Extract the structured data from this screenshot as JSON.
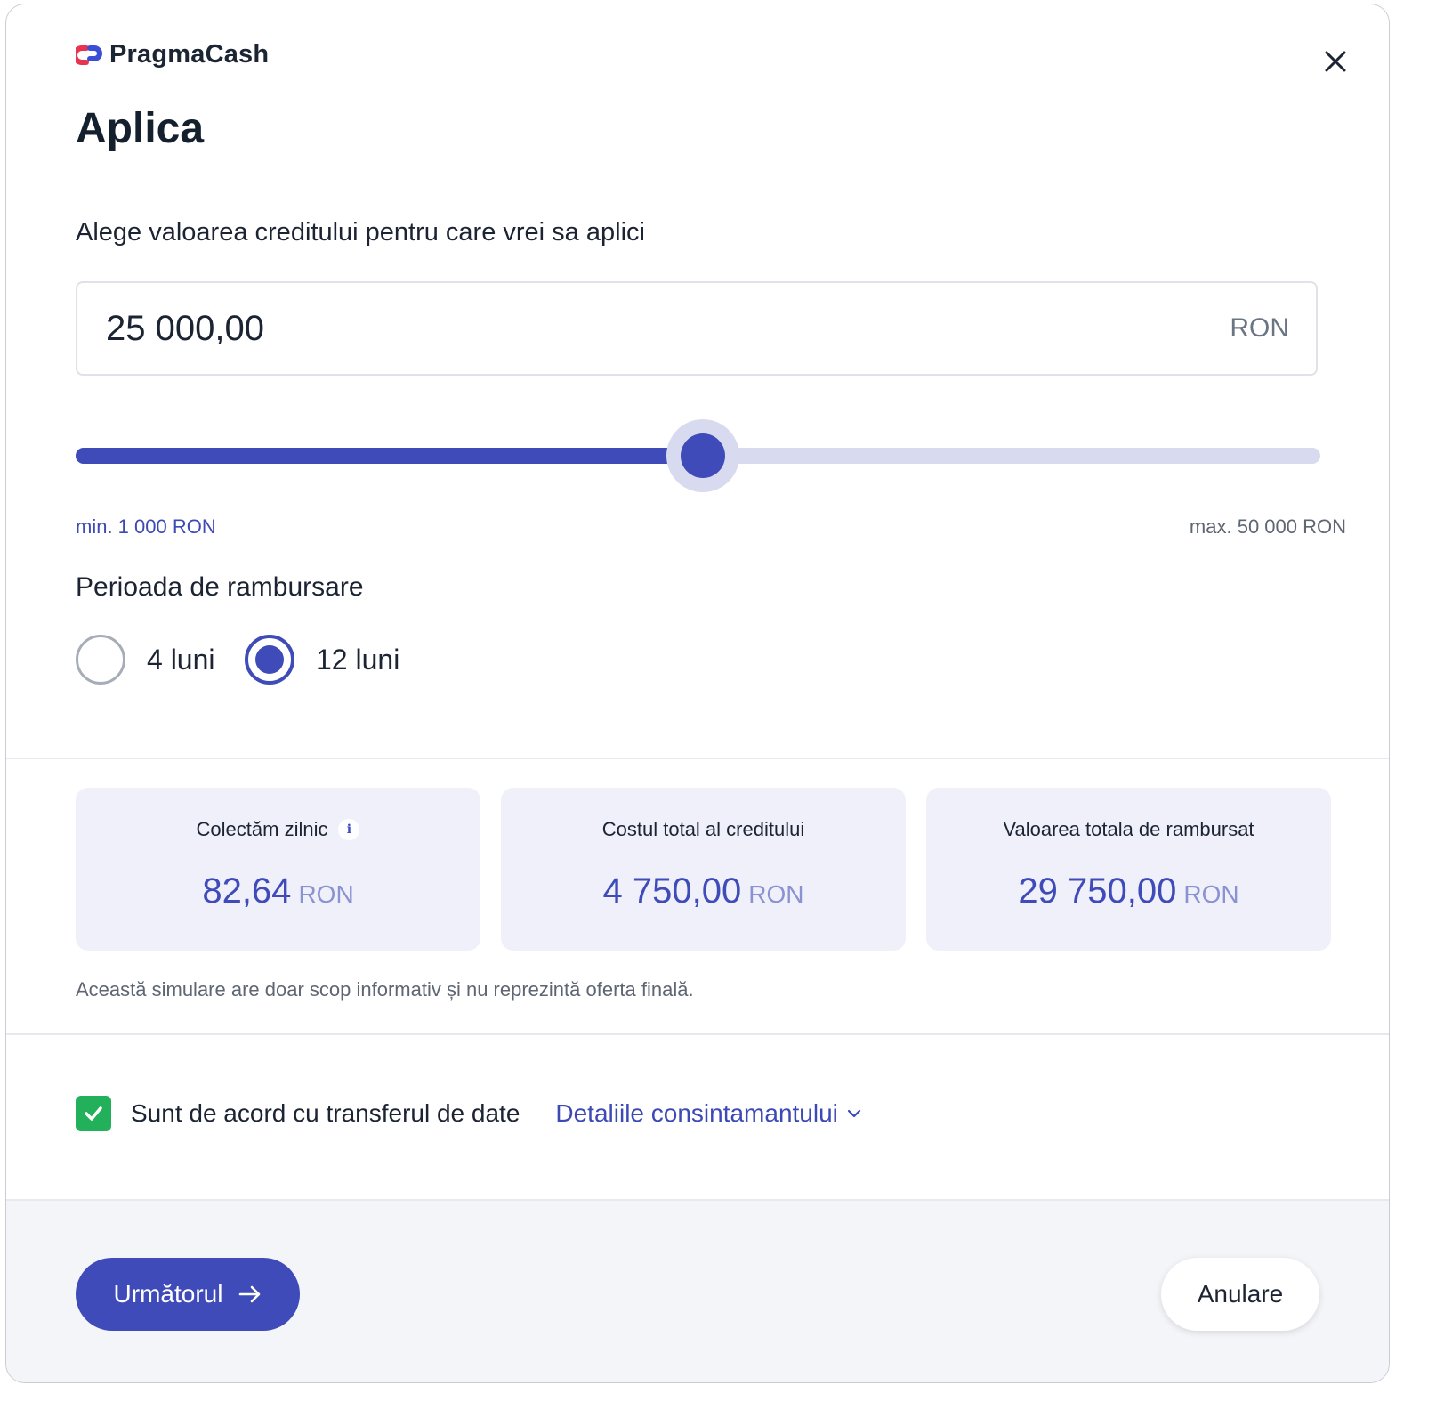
{
  "brand": {
    "name": "PragmaCash",
    "logo_icon": "pragmacash-logo-icon",
    "accent": "#3f4bb8",
    "logo_red": "#e8344e",
    "logo_blue": "#3b4fd6"
  },
  "close_icon": "close-icon",
  "title": "Aplica",
  "amount": {
    "label": "Alege valoarea creditului pentru care vrei sa aplici",
    "value": "25 000,00",
    "currency": "RON"
  },
  "slider": {
    "min_label": "min. 1 000 RON",
    "max_label": "max. 50 000 RON",
    "min": 1000,
    "max": 50000,
    "value": 25000
  },
  "period": {
    "label": "Perioada de rambursare",
    "options": [
      {
        "label": "4 luni",
        "selected": false
      },
      {
        "label": "12 luni",
        "selected": true
      }
    ]
  },
  "cards": [
    {
      "title": "Colectăm zilnic",
      "value": "82,64",
      "currency": "RON",
      "info_icon": "i"
    },
    {
      "title": "Costul total al creditului",
      "value": "4 750,00",
      "currency": "RON"
    },
    {
      "title": "Valoarea totala de rambursat",
      "value": "29 750,00",
      "currency": "RON"
    }
  ],
  "disclaimer": "Această simulare are doar scop informativ și nu reprezintă oferta finală.",
  "consent": {
    "label": "Sunt de acord cu transferul de date",
    "checked": true,
    "details_link": "Detaliile consintamantului",
    "check_color": "#22b05a"
  },
  "footer": {
    "next_label": "Următorul",
    "cancel_label": "Anulare"
  }
}
